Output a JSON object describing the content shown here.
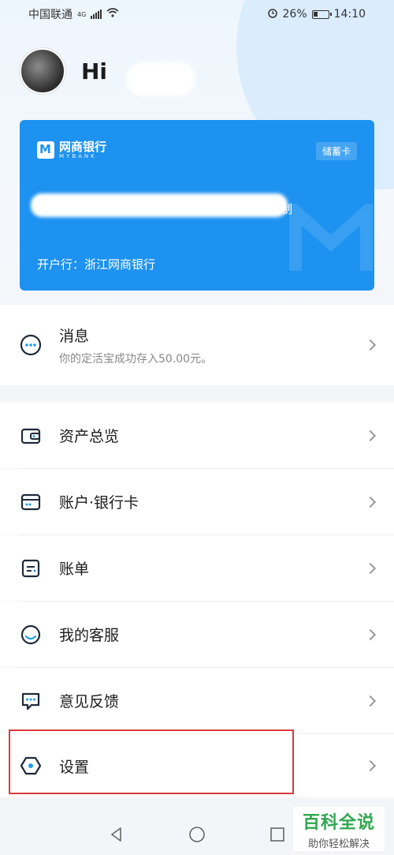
{
  "status_bar": {
    "carrier": "中国联通",
    "network": "4G",
    "battery": "26%",
    "time": "14:10"
  },
  "profile": {
    "greeting": "Hi"
  },
  "card": {
    "bank_name": "网商银行",
    "bank_name_en": "MYBANK",
    "card_type": "储蓄卡",
    "copy_label": "复制",
    "opening_bank": "开户行：浙江网商银行"
  },
  "messages": {
    "title": "消息",
    "subtitle": "你的定活宝成功存入50.00元。"
  },
  "menu": [
    {
      "label": "资产总览"
    },
    {
      "label": "账户·银行卡"
    },
    {
      "label": "账单"
    },
    {
      "label": "我的客服"
    },
    {
      "label": "意见反馈"
    },
    {
      "label": "设置"
    }
  ],
  "watermark": {
    "title": "百科全说",
    "subtitle": "助你轻松解决"
  },
  "colors": {
    "card_blue": "#1d92f0",
    "highlight_red": "#d93a3a"
  }
}
